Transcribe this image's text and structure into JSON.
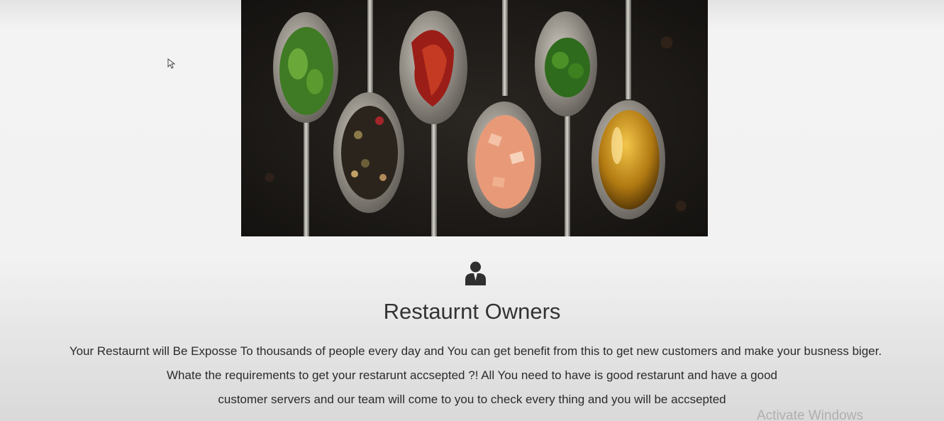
{
  "hero": {
    "image": "spices-on-spoons-photo"
  },
  "section": {
    "icon": "person-icon",
    "title": "Restaurnt Owners",
    "description_lines": [
      "Your Restaurnt will Be Exposse To thousands of people every day and You can get benefit from this to get new customers and make your busness biger.",
      "Whate the requirements to get your restarunt accsepted ?! All You need to have is good restarunt and have a good",
      "customer servers and our team will come to you to check every thing and you will be accsepted"
    ]
  },
  "os": {
    "watermark": "Activate Windows"
  },
  "cursor": {
    "icon": "mouse-pointer-icon"
  }
}
